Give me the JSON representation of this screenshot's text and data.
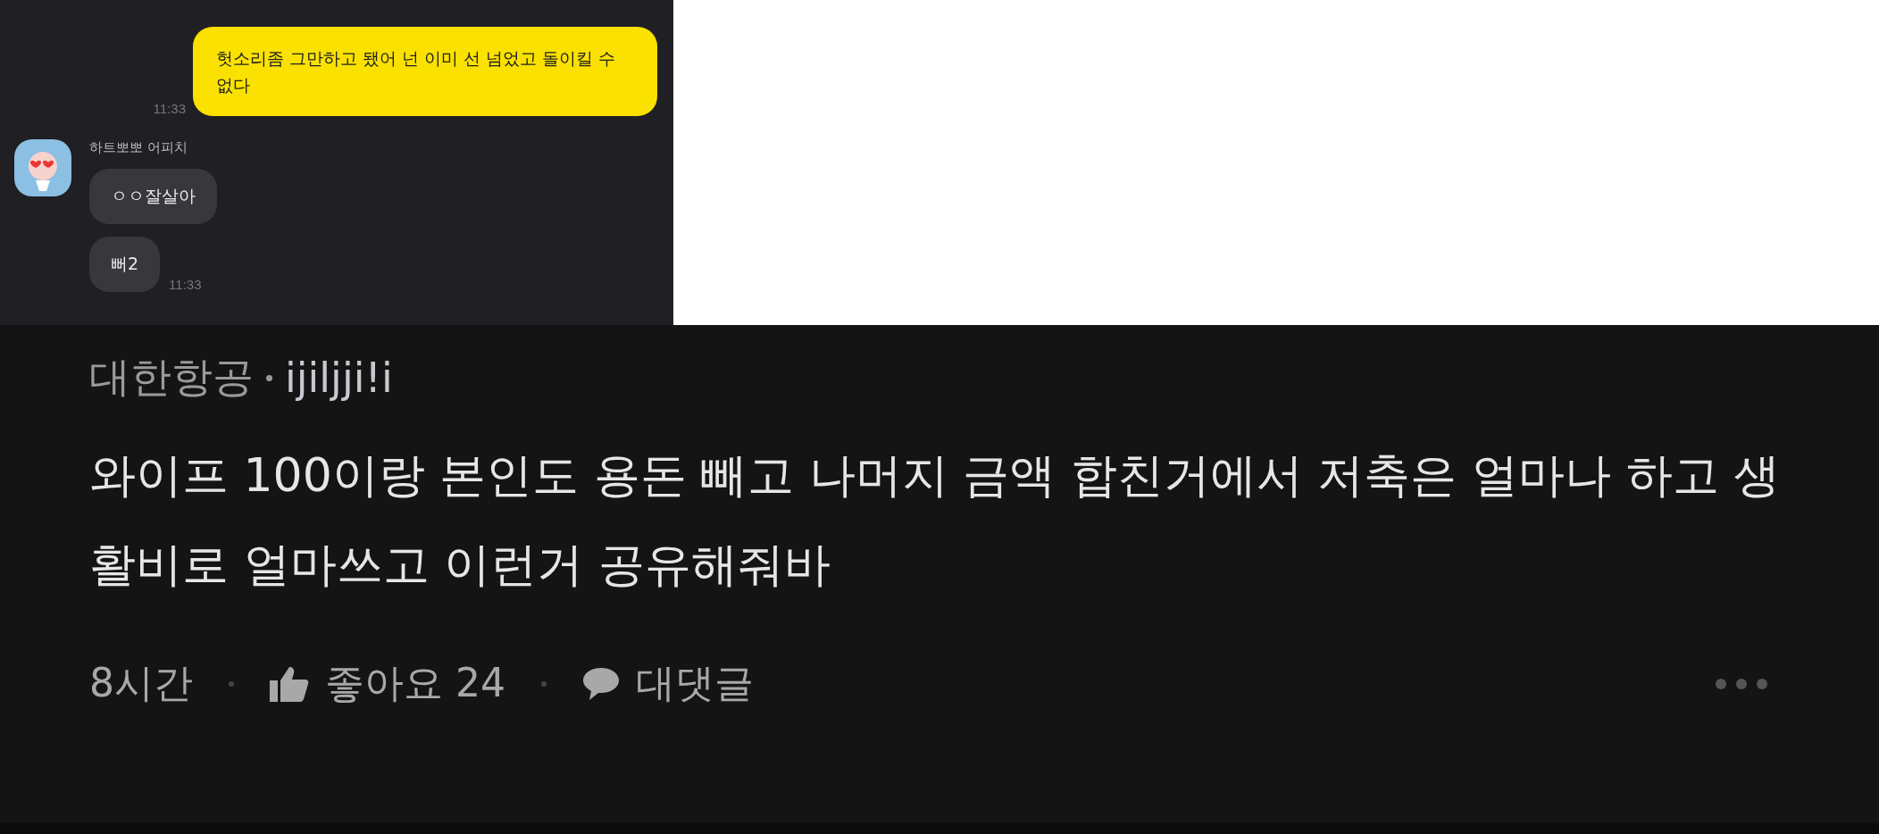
{
  "chat": {
    "sent": {
      "text": "헛소리좀 그만하고 됐어 넌 이미 선 넘었고 돌이킬 수 없다",
      "time": "11:33"
    },
    "received": {
      "sender": "하트뽀뽀 어피치",
      "messages": [
        "ㅇㅇ잘살아",
        "뻐2"
      ],
      "time": "11:33"
    }
  },
  "comment": {
    "author": "대한항공",
    "username": "ijiljji!i",
    "text": "와이프 100이랑 본인도 용돈 빼고 나머지 금액 합친거에서 저축은 얼마나 하고 생활비로 얼마쓰고 이런거 공유해줘바",
    "age": "8시간",
    "like_label": "좋아요 24",
    "reply_label": "대댓글"
  }
}
